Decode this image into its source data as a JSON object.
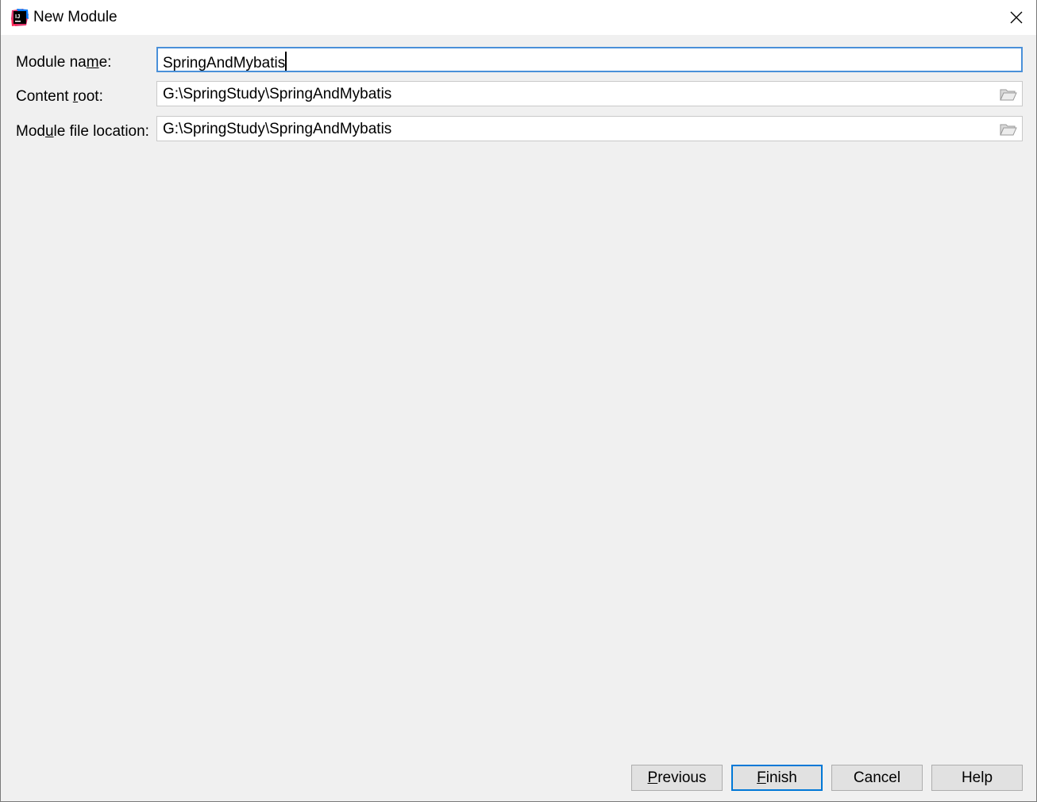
{
  "window": {
    "title": "New Module",
    "app_icon": "intellij-idea-icon",
    "close_icon": "close-icon"
  },
  "form": {
    "module_name": {
      "label_pre": "Module na",
      "label_mnemonic": "m",
      "label_post": "e:",
      "value": "SpringAndMybatis",
      "focused": true
    },
    "content_root": {
      "label_pre": "Content ",
      "label_mnemonic": "r",
      "label_post": "oot:",
      "value": "G:\\SpringStudy\\SpringAndMybatis",
      "browse_icon": "folder-open-icon"
    },
    "module_file_location": {
      "label_pre": "Mod",
      "label_mnemonic": "u",
      "label_post": "le file location:",
      "value": "G:\\SpringStudy\\SpringAndMybatis",
      "browse_icon": "folder-open-icon"
    }
  },
  "buttons": {
    "previous": {
      "mnemonic": "P",
      "rest": "revious"
    },
    "finish": {
      "mnemonic": "F",
      "rest": "inish"
    },
    "cancel": {
      "label": "Cancel"
    },
    "help": {
      "label": "Help"
    }
  },
  "colors": {
    "dialog_bg": "#f0f0f0",
    "focus_border": "#4a90d9",
    "default_button_border": "#0078d7",
    "button_bg": "#e1e1e1"
  }
}
